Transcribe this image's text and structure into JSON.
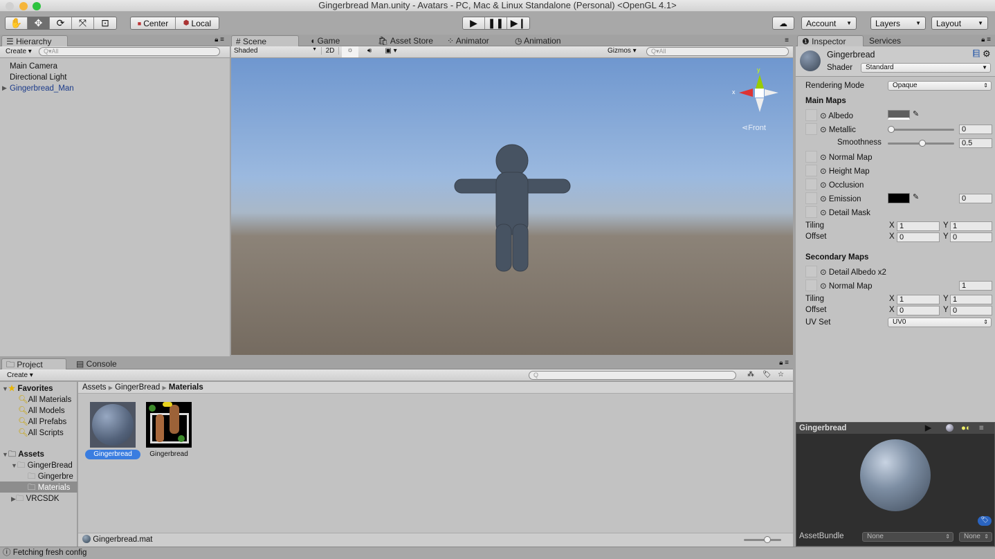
{
  "window": {
    "title": "Gingerbread Man.unity - Avatars - PC, Mac & Linux Standalone (Personal) <OpenGL 4.1>"
  },
  "toolbar": {
    "tools": [
      "hand-icon",
      "move-icon",
      "rotate-icon",
      "scale-icon",
      "rect-icon"
    ],
    "pivot": "Center",
    "space": "Local",
    "account": "Account",
    "layers": "Layers",
    "layout": "Layout"
  },
  "hierarchy": {
    "tab": "Hierarchy",
    "create": "Create",
    "search_placeholder": "All",
    "items": [
      "Main Camera",
      "Directional Light",
      "Gingerbread_Man"
    ]
  },
  "scene": {
    "tabs": [
      "Scene",
      "Game",
      "Asset Store",
      "Animator",
      "Animation"
    ],
    "shading": "Shaded",
    "mode_2d": "2D",
    "gizmos": "Gizmos",
    "search_placeholder": "All",
    "gizmo_label": "Front",
    "axis_x": "x",
    "axis_y": "y"
  },
  "inspector": {
    "tabs": [
      "Inspector",
      "Services"
    ],
    "name": "Gingerbread",
    "shader_label": "Shader",
    "shader": "Standard",
    "rendering_mode_label": "Rendering Mode",
    "rendering_mode": "Opaque",
    "main_maps": "Main Maps",
    "albedo": "Albedo",
    "metallic": "Metallic",
    "metallic_value": "0",
    "metallic_fraction": 0,
    "smoothness": "Smoothness",
    "smoothness_value": "0.5",
    "smoothness_fraction": 0.5,
    "normal_map": "Normal Map",
    "height_map": "Height Map",
    "occlusion": "Occlusion",
    "emission": "Emission",
    "emission_value": "0",
    "detail_mask": "Detail Mask",
    "tiling": "Tiling",
    "offset": "Offset",
    "x": "X",
    "y": "Y",
    "main_tiling": [
      "1",
      "1"
    ],
    "main_offset": [
      "0",
      "0"
    ],
    "secondary_maps": "Secondary Maps",
    "detail_albedo": "Detail Albedo x2",
    "sec_normal_map": "Normal Map",
    "sec_normal_value": "1",
    "sec_tiling": [
      "1",
      "1"
    ],
    "sec_offset": [
      "0",
      "0"
    ],
    "uv_set_label": "UV Set",
    "uv_set": "UV0",
    "albedo_color": "#5e5e5e",
    "emission_color": "#000000"
  },
  "preview": {
    "title": "Gingerbread",
    "assetbundle_label": "AssetBundle",
    "bundle": "None",
    "variant": "None"
  },
  "project": {
    "tabs": [
      "Project",
      "Console"
    ],
    "create": "Create",
    "favorites": "Favorites",
    "fav_items": [
      "All Materials",
      "All Models",
      "All Prefabs",
      "All Scripts"
    ],
    "assets": "Assets",
    "tree": [
      "GingerBread",
      "Gingerbre",
      "Materials",
      "VRCSDK"
    ],
    "breadcrumb": [
      "Assets",
      "GingerBread",
      "Materials"
    ],
    "files": [
      "Gingerbread",
      "Gingerbread"
    ],
    "selected_file": "Gingerbread.mat"
  },
  "status": {
    "message": "Fetching fresh config"
  }
}
